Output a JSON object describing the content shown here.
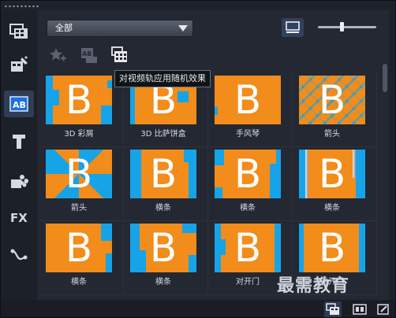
{
  "filter": {
    "category_value": "全部"
  },
  "toolbar": {
    "apply_random_tooltip": "对视频轨应用随机效果"
  },
  "thumbnails": {
    "letter": "B",
    "accent": "#f28c1a",
    "wipe_color": "#17a3e8",
    "items": [
      {
        "caption": "3D 彩屑"
      },
      {
        "caption": "3D 比萨饼盒"
      },
      {
        "caption": "手风琴"
      },
      {
        "caption": "箭头"
      },
      {
        "caption": "箭头"
      },
      {
        "caption": "横条"
      },
      {
        "caption": "横条"
      },
      {
        "caption": "横条"
      },
      {
        "caption": "横条"
      },
      {
        "caption": "横条"
      },
      {
        "caption": "对开门"
      },
      {
        "caption": "对开门"
      }
    ]
  },
  "watermark": {
    "text": "最需教育"
  },
  "sidebar": {
    "icons": [
      "media-library-icon",
      "instant-project-icon",
      "transition-icon",
      "title-icon",
      "graphic-icon",
      "filter-fx-icon",
      "path-icon"
    ]
  }
}
